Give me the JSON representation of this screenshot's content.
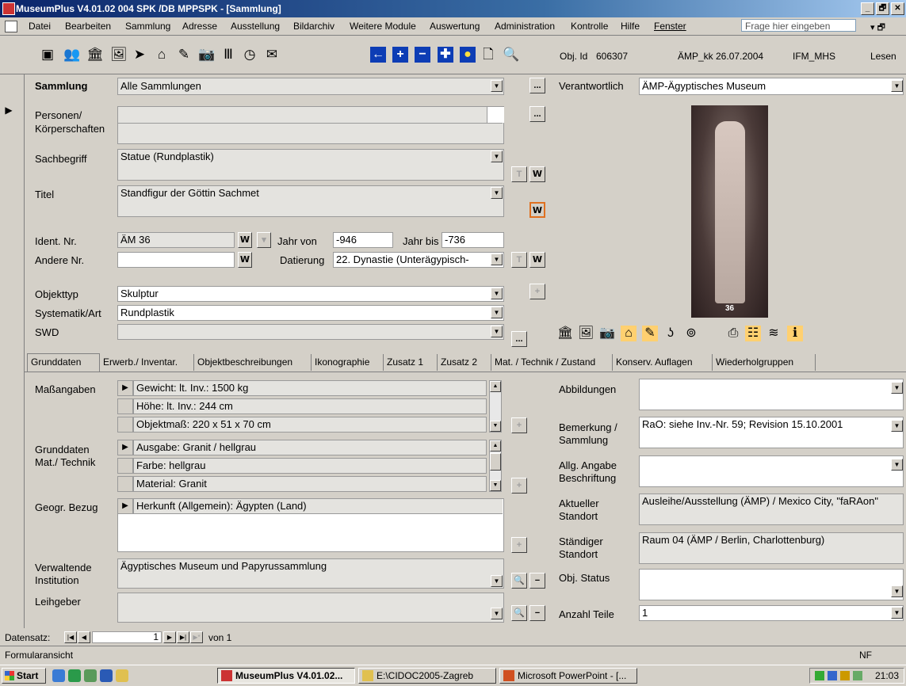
{
  "window": {
    "title": "MuseumPlus V4.01.02 004 SPK /DB MPPSPK - [Sammlung]",
    "minimize": "_",
    "restore": "🗗",
    "close": "✕"
  },
  "menubar": {
    "items": [
      "Datei",
      "Bearbeiten",
      "Sammlung",
      "Adresse",
      "Ausstellung",
      "Bildarchiv",
      "Weitere Module",
      "Auswertung",
      "Administration",
      "Kontrolle",
      "Hilfe",
      "Fenster"
    ],
    "help_placeholder": "Frage hier eingeben"
  },
  "toolbar": {
    "obj_id_label": "Obj. Id",
    "obj_id": "606307",
    "record_info": "ÄMP_kk 26.07.2004",
    "user": "IFM_MHS",
    "mode": "Lesen"
  },
  "header": {
    "sammlung_label": "Sammlung",
    "sammlung_value": "Alle Sammlungen",
    "verantwortlich_label": "Verantwortlich",
    "verantwortlich_value": "ÄMP-Ägyptisches Museum"
  },
  "form": {
    "personen_label": "Personen/",
    "koerperschaften_label": "Körperschaften",
    "sachbegriff_label": "Sachbegriff",
    "sachbegriff_value": "Statue (Rundplastik)",
    "titel_label": "Titel",
    "titel_value": "Standfigur der Göttin Sachmet",
    "ident_label": "Ident. Nr.",
    "ident_value": "ÄM 36",
    "jahr_von_label": "Jahr von",
    "jahr_von_value": "-946",
    "jahr_bis_label": "Jahr bis",
    "jahr_bis_value": "-736",
    "andere_label": "Andere Nr.",
    "andere_value": "",
    "datierung_label": "Datierung",
    "datierung_value": "22. Dynastie (Unterägypisch-",
    "objekttyp_label": "Objekttyp",
    "objekttyp_value": "Skulptur",
    "systematik_label": "Systematik/Art",
    "systematik_value": "Rundplastik",
    "swd_label": "SWD",
    "swd_value": "",
    "w_label": "W",
    "ellipsis": "..."
  },
  "photo": {
    "label_number": "36"
  },
  "tabs": [
    "Grunddaten",
    "Erwerb./ Inventar.",
    "Objektbeschreibungen",
    "Ikonographie",
    "Zusatz 1",
    "Zusatz 2",
    "Mat. / Technik / Zustand",
    "Konserv. Auflagen",
    "Wiederholgruppen"
  ],
  "grunddaten": {
    "massangaben_label": "Maßangaben",
    "massangaben_rows": [
      "Gewicht: lt. Inv.: 1500 kg",
      "Höhe: lt. Inv.: 244 cm",
      "Objektmaß: 220 x 51 x 70 cm"
    ],
    "mat_label_1": "Grunddaten",
    "mat_label_2": "Mat./ Technik",
    "mat_rows": [
      "Ausgabe: Granit / hellgrau",
      "Farbe: hellgrau",
      "Material: Granit"
    ],
    "geogr_label": "Geogr. Bezug",
    "geogr_rows": [
      "Herkunft (Allgemein): Ägypten (Land)"
    ],
    "verwaltende_label_1": "Verwaltende",
    "verwaltende_label_2": "Institution",
    "verwaltende_value": "Ägyptisches Museum und Papyrussammlung",
    "leihgeber_label": "Leihgeber",
    "leihgeber_value": "",
    "abbildungen_label": "Abbildungen",
    "abbildungen_value": "",
    "bemerkung_label_1": "Bemerkung /",
    "bemerkung_label_2": "Sammlung",
    "bemerkung_value": "RaO: siehe Inv.-Nr. 59; Revision 15.10.2001",
    "allg_label_1": "Allg. Angabe",
    "allg_label_2": "Beschriftung",
    "allg_value": "",
    "aktueller_label_1": "Aktueller",
    "aktueller_label_2": "Standort",
    "aktueller_value": "Ausleihe/Ausstellung (ÄMP) / Mexico City, \"faRAon\"",
    "staendiger_label_1": "Ständiger",
    "staendiger_label_2": "Standort",
    "staendiger_value": "Raum 04 (ÄMP / Berlin, Charlottenburg)",
    "status_label": "Obj. Status",
    "status_value": "",
    "anzahl_label": "Anzahl Teile",
    "anzahl_value": "1"
  },
  "statusbar": {
    "datensatz_label": "Datensatz:",
    "record_number": "1",
    "von_label": "von 1",
    "view_label": "Formularansicht",
    "nf": "NF"
  },
  "taskbar": {
    "start_label": "Start",
    "tasks": [
      "MuseumPlus V4.01.02...",
      "E:\\CIDOC2005-Zagreb",
      "Microsoft PowerPoint - [..."
    ],
    "clock": "21:03"
  }
}
